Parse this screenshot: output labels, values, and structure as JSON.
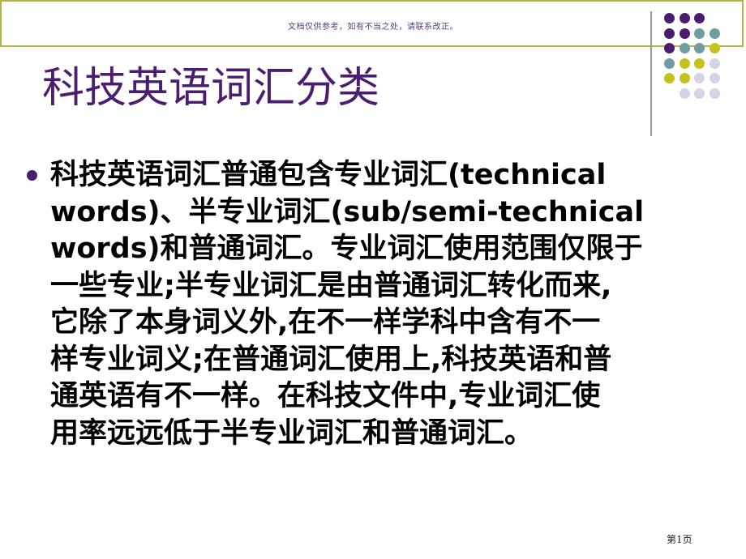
{
  "header": {
    "notice": "文档仅供参考，如有不当之处，请联系改正。"
  },
  "decoration": {
    "dot_colors": {
      "purple": "#4b1d6e",
      "teal": "#6f9ea0",
      "olive": "#c3c320",
      "lavender": "#d6d3e6"
    },
    "dot_rows": [
      [
        "purple",
        "purple",
        "purple"
      ],
      [
        "purple",
        "purple",
        "teal",
        "teal"
      ],
      [
        "purple",
        "teal",
        "teal",
        "olive"
      ],
      [
        "teal",
        "olive",
        "olive",
        "lavender"
      ],
      [
        "olive",
        "olive",
        "lavender",
        "lavender"
      ],
      [
        "lavender",
        "lavender",
        "lavender"
      ]
    ]
  },
  "slide": {
    "title": "科技英语词汇分类",
    "body_lines": [
      "科技英语词汇普通包含专业词汇(technical",
      "words)、半专业词汇(sub/semi-technical",
      "words)和普通词汇。专业词汇使用范围仅限于",
      "一些专业;半专业词汇是由普通词汇转化而来,",
      "它除了本身词义外,在不一样学科中含有不一",
      "样专业词义;在普通词汇使用上,科技英语和普",
      "通英语有不一样。在科技文件中,专业词汇使",
      "用率远远低于半专业词汇和普通词汇。"
    ],
    "page_number": "第1页"
  }
}
